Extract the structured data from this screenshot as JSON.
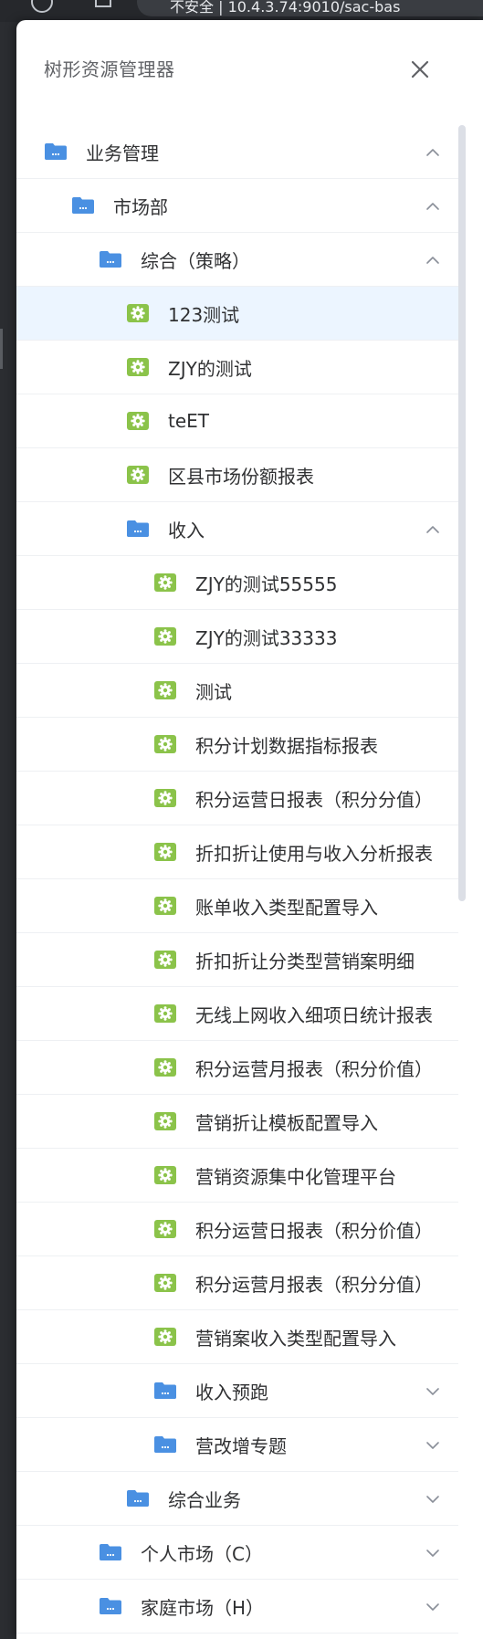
{
  "browser": {
    "address_text": "不安全 | 10.4.3.74:9010/sac-bas"
  },
  "drawer": {
    "title": "树形资源管理器",
    "close_icon": "close-icon"
  },
  "colors": {
    "folder": "#4a90e2",
    "report": "#8bc34a",
    "selected_bg": "#ecf5ff",
    "text": "#303133",
    "title": "#606266"
  },
  "tree": [
    {
      "label": "业务管理",
      "type": "folder",
      "depth": 0,
      "expanded": true
    },
    {
      "label": "市场部",
      "type": "folder",
      "depth": 1,
      "expanded": true
    },
    {
      "label": "综合（策略）",
      "type": "folder",
      "depth": 2,
      "expanded": true
    },
    {
      "label": "123测试",
      "type": "report",
      "depth": 3,
      "selected": true
    },
    {
      "label": "ZJY的测试",
      "type": "report",
      "depth": 3
    },
    {
      "label": "teET",
      "type": "report",
      "depth": 3
    },
    {
      "label": "区县市场份额报表",
      "type": "report",
      "depth": 3
    },
    {
      "label": "收入",
      "type": "folder",
      "depth": 3,
      "expanded": true
    },
    {
      "label": "ZJY的测试55555",
      "type": "report",
      "depth": 4
    },
    {
      "label": "ZJY的测试33333",
      "type": "report",
      "depth": 4
    },
    {
      "label": "测试",
      "type": "report",
      "depth": 4
    },
    {
      "label": "积分计划数据指标报表",
      "type": "report",
      "depth": 4
    },
    {
      "label": "积分运营日报表（积分分值）",
      "type": "report",
      "depth": 4
    },
    {
      "label": "折扣折让使用与收入分析报表",
      "type": "report",
      "depth": 4
    },
    {
      "label": "账单收入类型配置导入",
      "type": "report",
      "depth": 4
    },
    {
      "label": "折扣折让分类型营销案明细",
      "type": "report",
      "depth": 4
    },
    {
      "label": "无线上网收入细项日统计报表",
      "type": "report",
      "depth": 4
    },
    {
      "label": "积分运营月报表（积分价值）",
      "type": "report",
      "depth": 4
    },
    {
      "label": "营销折让模板配置导入",
      "type": "report",
      "depth": 4
    },
    {
      "label": "营销资源集中化管理平台",
      "type": "report",
      "depth": 4
    },
    {
      "label": "积分运营日报表（积分价值）",
      "type": "report",
      "depth": 4
    },
    {
      "label": "积分运营月报表（积分分值）",
      "type": "report",
      "depth": 4
    },
    {
      "label": "营销案收入类型配置导入",
      "type": "report",
      "depth": 4
    },
    {
      "label": "收入预跑",
      "type": "folder",
      "depth": 4,
      "expanded": false
    },
    {
      "label": "营改增专题",
      "type": "folder",
      "depth": 4,
      "expanded": false
    },
    {
      "label": "综合业务",
      "type": "folder",
      "depth": 3,
      "expanded": false
    },
    {
      "label": "个人市场（C）",
      "type": "folder",
      "depth": 2,
      "expanded": false
    },
    {
      "label": "家庭市场（H）",
      "type": "folder",
      "depth": 2,
      "expanded": false
    }
  ]
}
